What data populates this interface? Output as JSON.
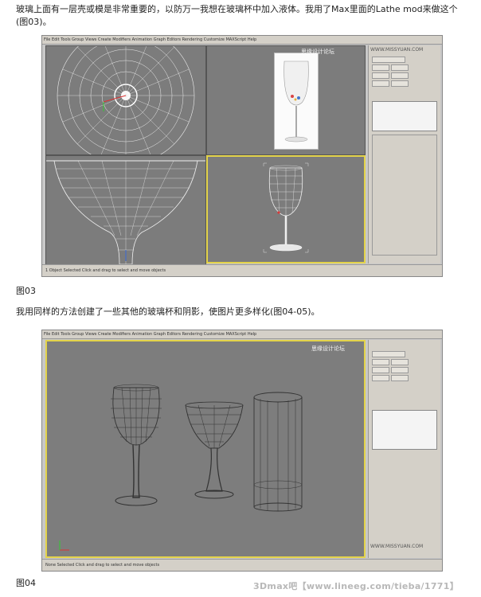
{
  "article": {
    "paragraph1": "玻璃上面有一层壳或模是非常重要的，以防万一我想在玻璃杯中加入液体。我用了Max里面的Lathe mod来做这个(图03)。",
    "caption1": "图03",
    "paragraph2": "我用同样的方法创建了一些其他的玻璃杯和阴影，使图片更多样化(图04-05)。",
    "caption2": "图04"
  },
  "watermark": {
    "site": "思缘设计论坛",
    "url": "WWW.MISSYUAN.COM",
    "footer": "3Dmax吧【www.lineeg.com/tieba/1771】"
  },
  "screenshot1": {
    "menu": "File  Edit  Tools  Group  Views  Create  Modifiers  Animation  Graph Editors  Rendering  Customize  MAXScript  Help",
    "status": "1 Object Selected     Click and drag to select and move objects"
  },
  "screenshot2": {
    "menu": "File  Edit  Tools  Group  Views  Create  Modifiers  Animation  Graph Editors  Rendering  Customize  MAXScript  Help",
    "status": "None Selected     Click and drag to select and move objects"
  }
}
